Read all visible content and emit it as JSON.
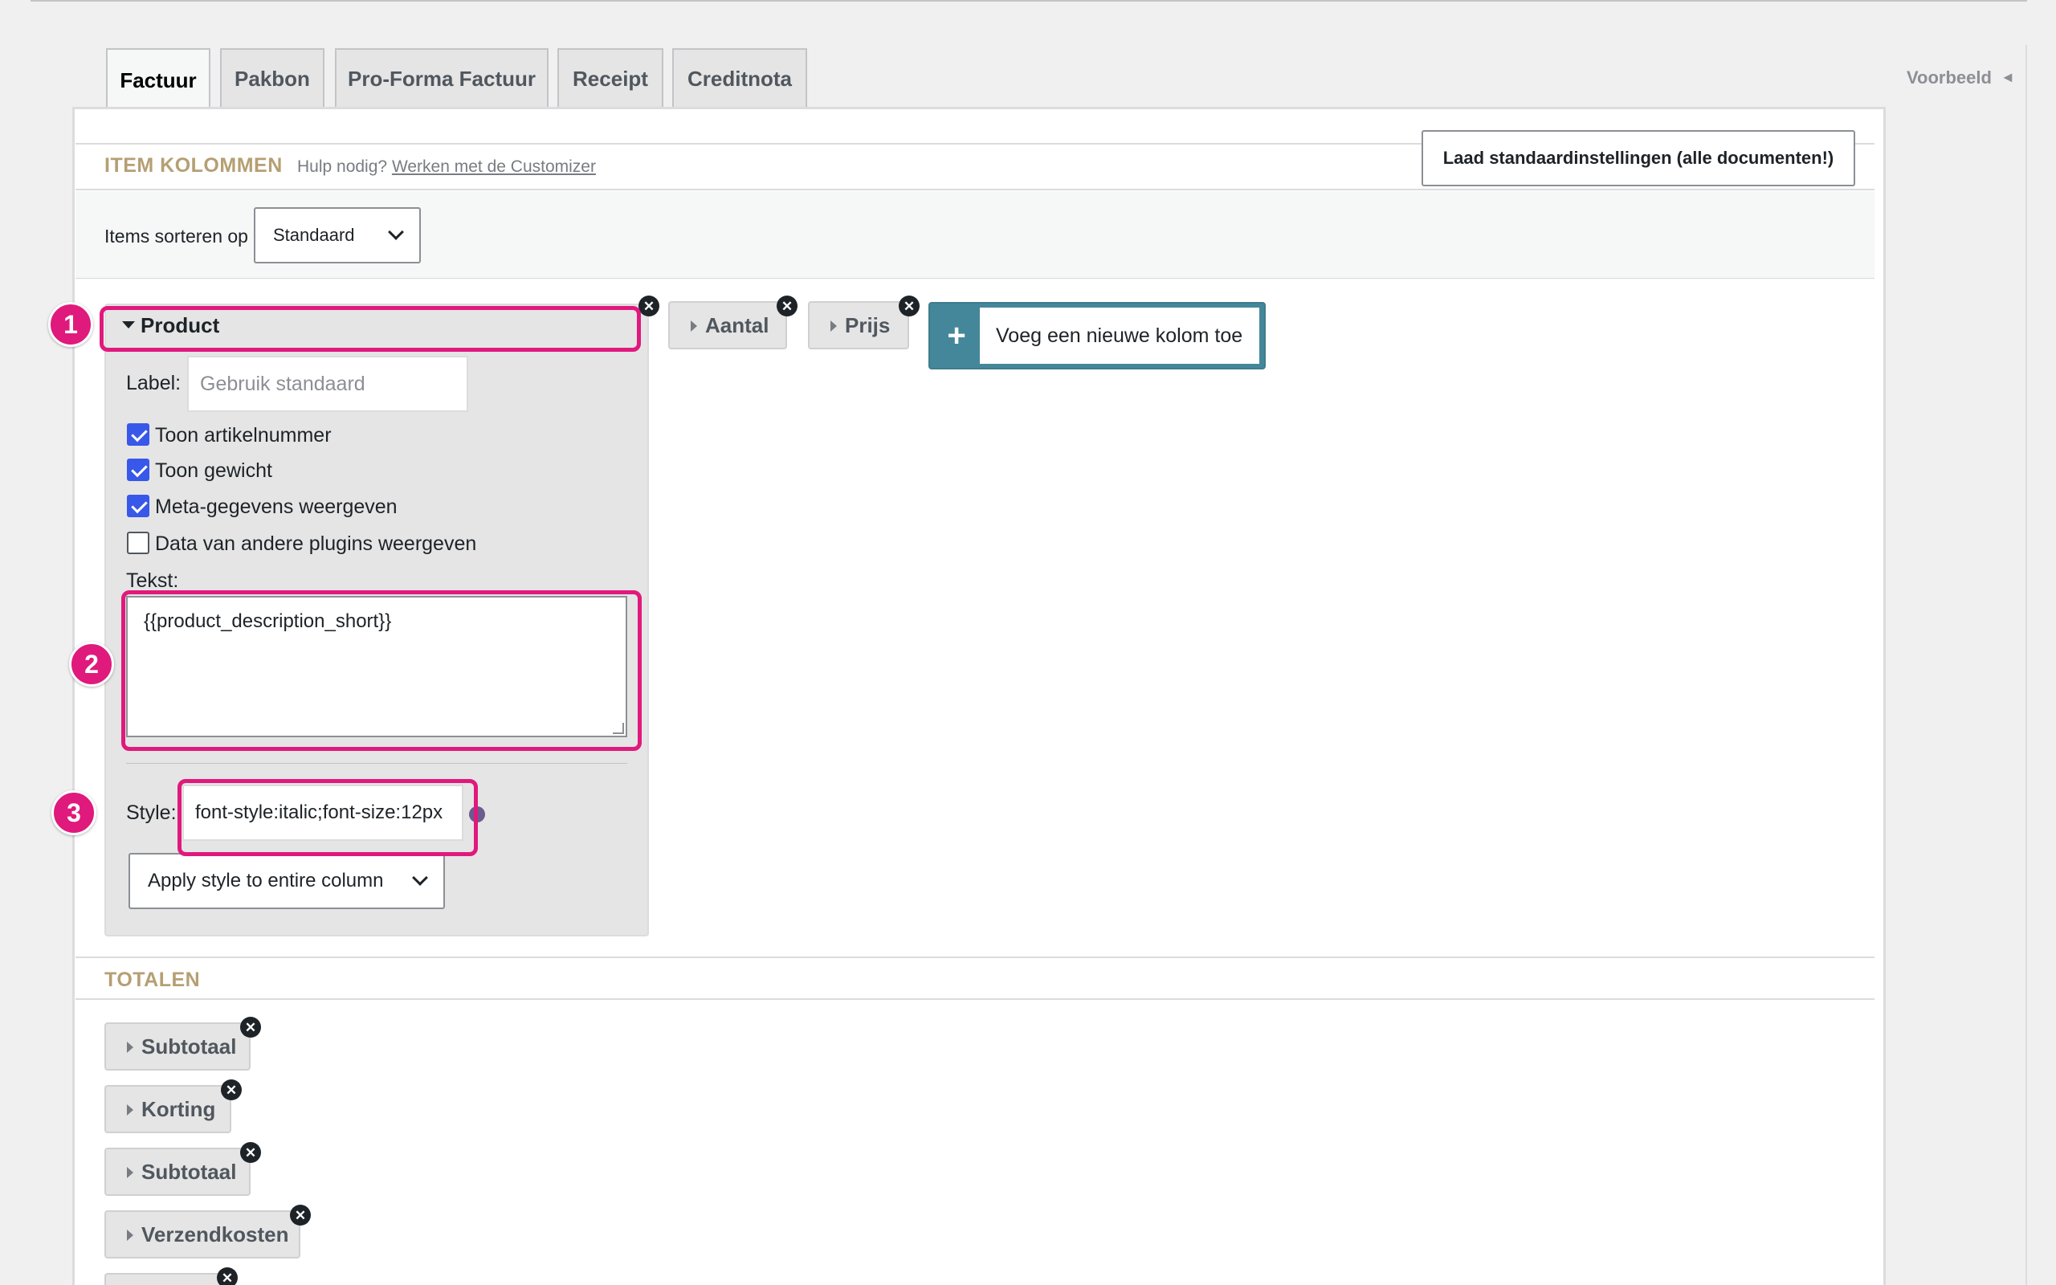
{
  "tabs": [
    {
      "label": "Factuur",
      "active": true
    },
    {
      "label": "Pakbon"
    },
    {
      "label": "Pro-Forma Factuur"
    },
    {
      "label": "Receipt"
    },
    {
      "label": "Creditnota"
    }
  ],
  "preview": {
    "label": "Voorbeeld",
    "arrow": "◄"
  },
  "item_columns": {
    "title": "ITEM KOLOMMEN",
    "help_prefix": "Hulp nodig?",
    "help_link": "Werken met de Customizer",
    "reset_button": "Laad standaardinstellingen (alle documenten!)",
    "sort_label": "Items sorteren op",
    "sort_value": "Standaard",
    "columns": [
      "Product",
      "Aantal",
      "Prijs"
    ],
    "add_column_placeholder": "Voeg een nieuwe kolom toe"
  },
  "product": {
    "label_field_label": "Label:",
    "label_placeholder": "Gebruik standaard",
    "options": [
      {
        "label": "Toon artikelnummer",
        "checked": true
      },
      {
        "label": "Toon gewicht",
        "checked": true
      },
      {
        "label": "Meta-gegevens weergeven",
        "checked": true
      },
      {
        "label": "Data van andere plugins weergeven",
        "checked": false
      }
    ],
    "text_label": "Tekst:",
    "text_value": "{{product_description_short}}",
    "style_label": "Style:",
    "style_value": "font-style:italic;font-size:12px",
    "apply_select": "Apply style to entire column"
  },
  "totals": {
    "title": "TOTALEN",
    "items": [
      "Subtotaal",
      "Korting",
      "Subtotaal",
      "Verzendkosten"
    ]
  },
  "annotations": [
    "1",
    "2",
    "3"
  ],
  "colors": {
    "highlight": "#e0197d",
    "accent": "#45879a",
    "section_title": "#b59f73"
  }
}
